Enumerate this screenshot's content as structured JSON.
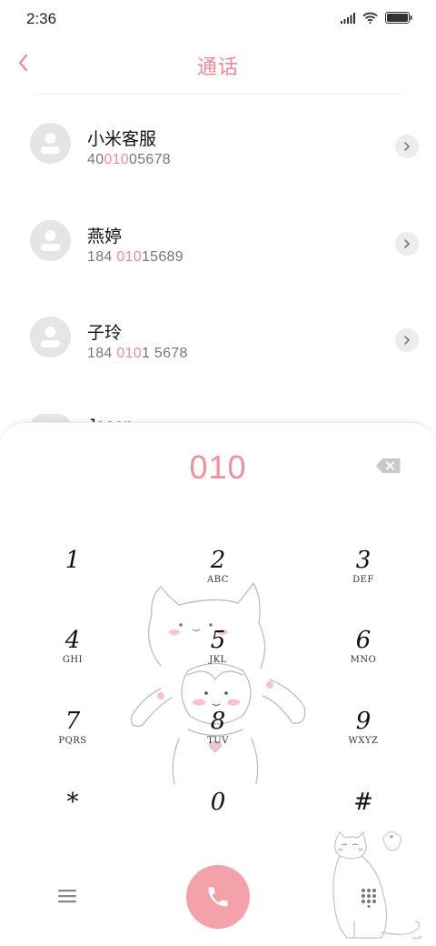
{
  "status_bar": {
    "time": "2:36",
    "icons": [
      "signal-icon",
      "wifi-icon",
      "battery-icon"
    ]
  },
  "header": {
    "title": "通话",
    "back_icon": "chevron-left-icon"
  },
  "contacts": [
    {
      "name": "小米客服",
      "number_parts": [
        "40",
        "010",
        "05678"
      ]
    },
    {
      "name": "燕婷",
      "number_parts": [
        "184 ",
        "010",
        "15689"
      ]
    },
    {
      "name": "子玲",
      "number_parts": [
        "184 ",
        "010",
        "1 5678"
      ]
    }
  ],
  "peek_contact": {
    "name": "Jason"
  },
  "dialer": {
    "input_value": "010",
    "keys": [
      {
        "digit": "1",
        "letters": ""
      },
      {
        "digit": "2",
        "letters": "ABC"
      },
      {
        "digit": "3",
        "letters": "DEF"
      },
      {
        "digit": "4",
        "letters": "GHI"
      },
      {
        "digit": "5",
        "letters": "JKL"
      },
      {
        "digit": "6",
        "letters": "MNO"
      },
      {
        "digit": "7",
        "letters": "PQRS"
      },
      {
        "digit": "8",
        "letters": "TUV"
      },
      {
        "digit": "9",
        "letters": "WXYZ"
      },
      {
        "digit": "*",
        "letters": ""
      },
      {
        "digit": "0",
        "letters": ""
      },
      {
        "digit": "#",
        "letters": ""
      }
    ]
  },
  "colors": {
    "accent": "#f08a96",
    "call_button": "#f3a2a9",
    "avatar_bg": "#e5e5e7"
  }
}
